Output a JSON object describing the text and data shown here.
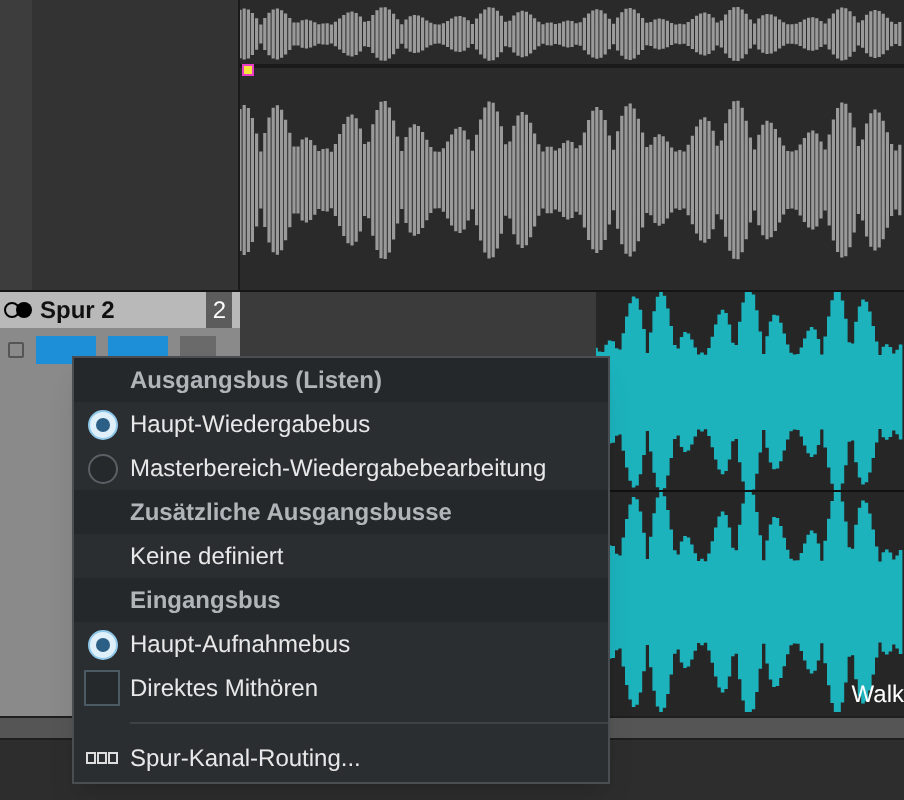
{
  "track": {
    "name": "Spur 2",
    "number": "2"
  },
  "clip_label": "Walk",
  "menu": [
    {
      "kind": "header",
      "label": "Ausgangsbus (Listen)"
    },
    {
      "kind": "radio",
      "label": "Haupt-Wiedergabebus",
      "selected": true
    },
    {
      "kind": "radio",
      "label": "Masterbereich-Wiedergabebearbeitung",
      "selected": false
    },
    {
      "kind": "header",
      "label": "Zusätzliche Ausgangsbusse"
    },
    {
      "kind": "item",
      "label": "Keine definiert"
    },
    {
      "kind": "header",
      "label": "Eingangsbus"
    },
    {
      "kind": "radio",
      "label": "Haupt-Aufnahmebus",
      "selected": true
    },
    {
      "kind": "check",
      "label": "Direktes Mithören",
      "checked": false
    },
    {
      "kind": "separator"
    },
    {
      "kind": "routing",
      "label": "Spur-Kanal-Routing..."
    }
  ]
}
